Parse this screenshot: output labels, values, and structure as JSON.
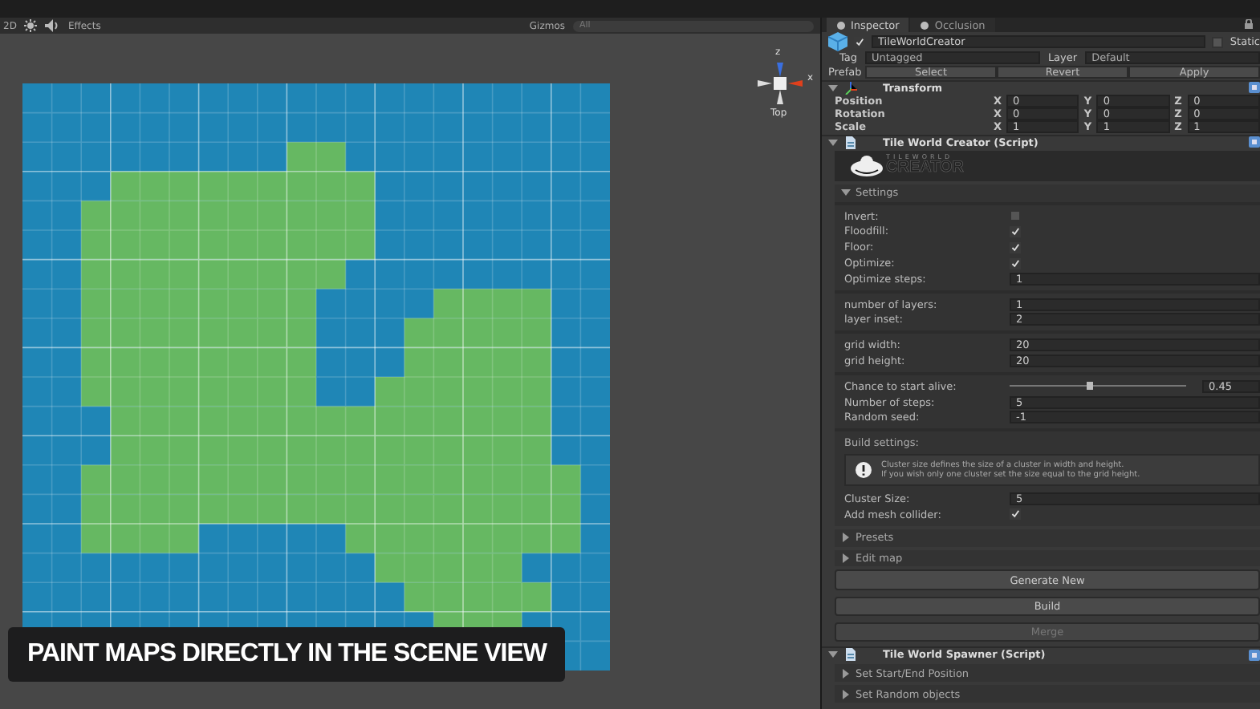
{
  "scene": {
    "toolbar": {
      "mode": "2D",
      "effects": "Effects",
      "gizmos": "Gizmos",
      "search": {
        "placeholder": "All"
      }
    },
    "gizmo": {
      "z": "z",
      "x": "x",
      "view": "Top"
    },
    "caption": "PAINT MAPS DIRECTLY IN THE SCENE VIEW"
  },
  "inspector": {
    "tabs": [
      {
        "label": "Inspector",
        "selected": true
      },
      {
        "label": "Occlusion",
        "selected": false
      }
    ],
    "object": {
      "active": true,
      "name": "TileWorldCreator",
      "static_label": "Static",
      "static": false
    },
    "tag": {
      "label": "Tag",
      "value": "Untagged"
    },
    "layer": {
      "label": "Layer",
      "value": "Default"
    },
    "prefab": {
      "label": "Prefab",
      "buttons": [
        "Select",
        "Revert",
        "Apply"
      ]
    },
    "transform": {
      "title": "Transform",
      "expanded": true,
      "rows": [
        {
          "label": "Position",
          "fields": [
            {
              "axis": "X",
              "value": "0"
            },
            {
              "axis": "Y",
              "value": "0"
            },
            {
              "axis": "Z",
              "value": "0"
            }
          ]
        },
        {
          "label": "Rotation",
          "fields": [
            {
              "axis": "X",
              "value": "0"
            },
            {
              "axis": "Y",
              "value": "0"
            },
            {
              "axis": "Z",
              "value": "0"
            }
          ]
        },
        {
          "label": "Scale",
          "fields": [
            {
              "axis": "X",
              "value": "1"
            },
            {
              "axis": "Y",
              "value": "1"
            },
            {
              "axis": "Z",
              "value": "1"
            }
          ]
        }
      ]
    },
    "creator": {
      "title": "Tile World Creator (Script)",
      "expanded": true,
      "logo": {
        "top": "TILEWORLD",
        "bottom": "CREATOR"
      },
      "settings": {
        "title": "Settings",
        "expanded": true,
        "groups": [
          [
            {
              "kind": "checkbox",
              "label": "Invert:",
              "checked": false
            },
            {
              "kind": "checkbox",
              "label": "Floodfill:",
              "checked": true
            },
            {
              "kind": "checkbox",
              "label": "Floor:",
              "checked": true
            },
            {
              "kind": "checkbox",
              "label": "Optimize:",
              "checked": true
            },
            {
              "kind": "field",
              "label": "Optimize steps:",
              "value": "1"
            }
          ],
          [
            {
              "kind": "field",
              "label": "number of layers:",
              "value": "1"
            },
            {
              "kind": "field",
              "label": "layer inset:",
              "value": "2"
            }
          ],
          [
            {
              "kind": "field",
              "label": "grid width:",
              "value": "20"
            },
            {
              "kind": "field",
              "label": "grid height:",
              "value": "20"
            }
          ],
          [
            {
              "kind": "slider",
              "label": "Chance to start alive:",
              "level": 0.45,
              "reading": "0.45"
            },
            {
              "kind": "field",
              "label": "Number of steps:",
              "value": "5"
            },
            {
              "kind": "field",
              "label": "Random seed:",
              "value": "-1"
            }
          ]
        ],
        "build": {
          "title": "Build settings:",
          "help": [
            "Cluster size defines the size of a cluster in width and height.",
            "If you wish only one cluster set the size equal to the grid height."
          ],
          "rows": [
            {
              "kind": "field",
              "label": "Cluster Size:",
              "value": "5"
            },
            {
              "kind": "checkbox",
              "label": "Add mesh collider:",
              "checked": true
            }
          ]
        }
      },
      "foldouts": [
        {
          "label": "Presets",
          "expanded": false
        },
        {
          "label": "Edit map",
          "expanded": false
        }
      ],
      "buttons": [
        {
          "label": "Generate New",
          "disabled": false
        },
        {
          "label": "Build",
          "disabled": false
        },
        {
          "label": "Merge",
          "disabled": true
        }
      ]
    },
    "spawner": {
      "title": "Tile World Spawner (Script)",
      "expanded": true,
      "foldouts": [
        {
          "label": "Set Start/End Position",
          "expanded": false
        },
        {
          "label": "Set Random objects",
          "expanded": false
        }
      ]
    }
  }
}
